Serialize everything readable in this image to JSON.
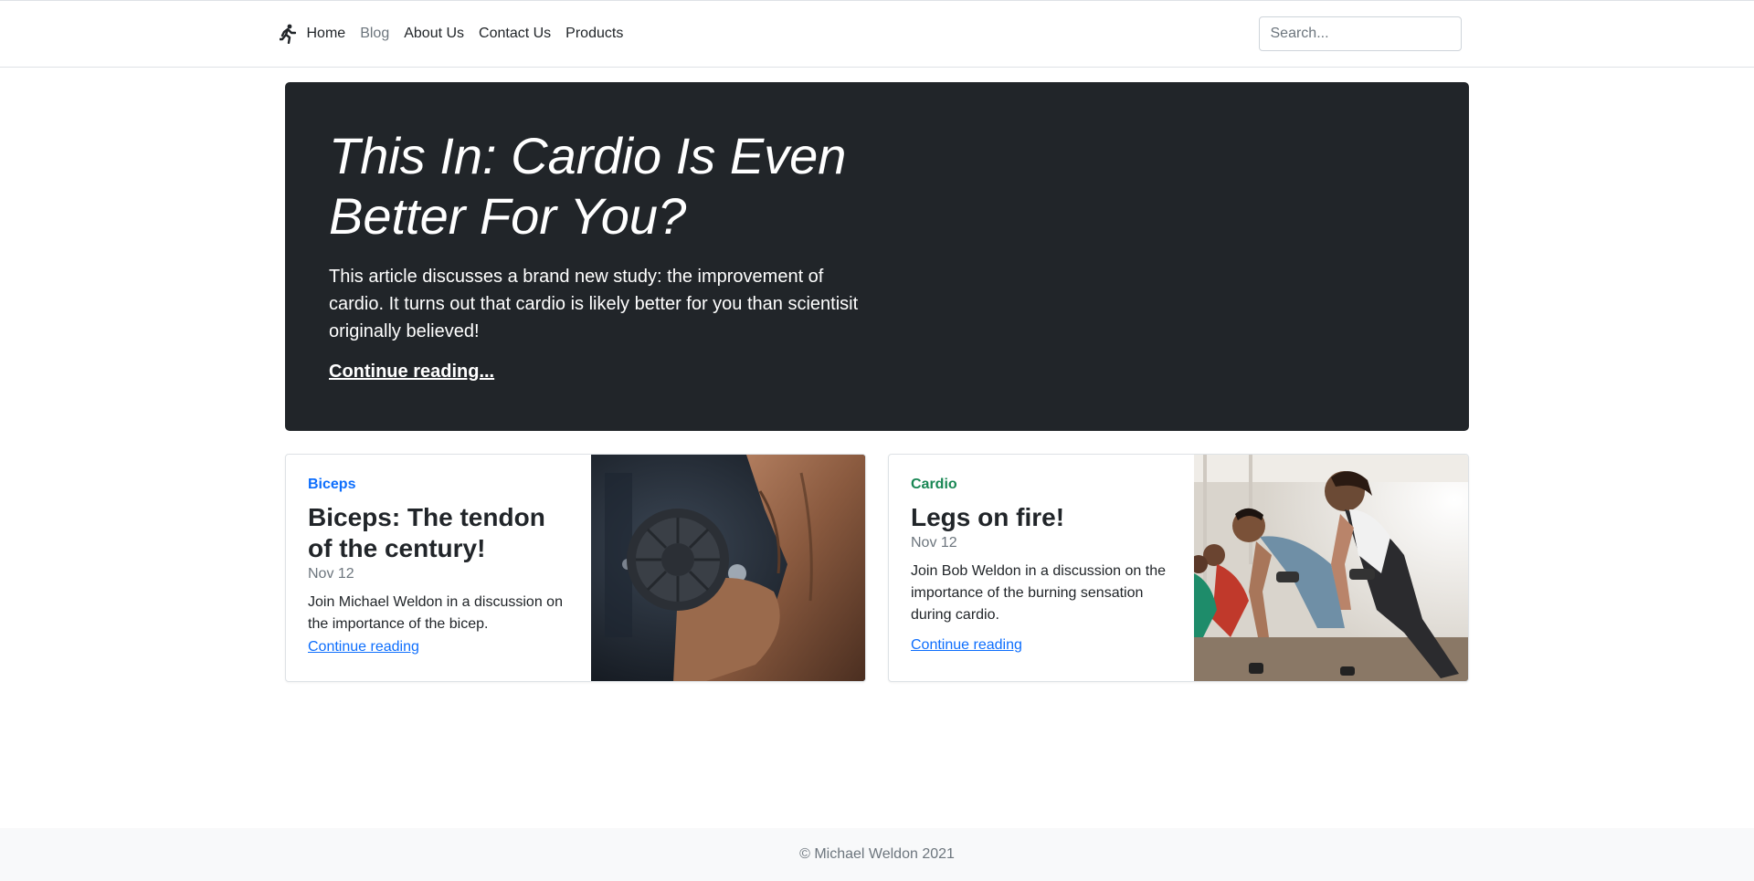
{
  "nav": {
    "links": [
      "Home",
      "Blog",
      "About Us",
      "Contact Us",
      "Products"
    ],
    "active": "Blog",
    "search_placeholder": "Search..."
  },
  "hero": {
    "title": "This In: Cardio Is Even Better For You?",
    "lead": "This article discusses a brand new study: the improvement of cardio. It turns out that cardio is likely better for you than scientisit originally believed!",
    "link": "Continue reading..."
  },
  "cards": [
    {
      "category": "Biceps",
      "category_color": "#0d6efd",
      "title": "Biceps: The tendon of the century!",
      "date": "Nov 12",
      "text": "Join Michael Weldon in a discussion on the importance of the bicep.",
      "link": "Continue reading"
    },
    {
      "category": "Cardio",
      "category_color": "#198754",
      "title": "Legs on fire!",
      "date": "Nov 12",
      "text": "Join Bob Weldon in a discussion on the importance of the burning sensation during cardio.",
      "link": "Continue reading"
    }
  ],
  "footer": {
    "text": "© Michael Weldon 2021"
  }
}
